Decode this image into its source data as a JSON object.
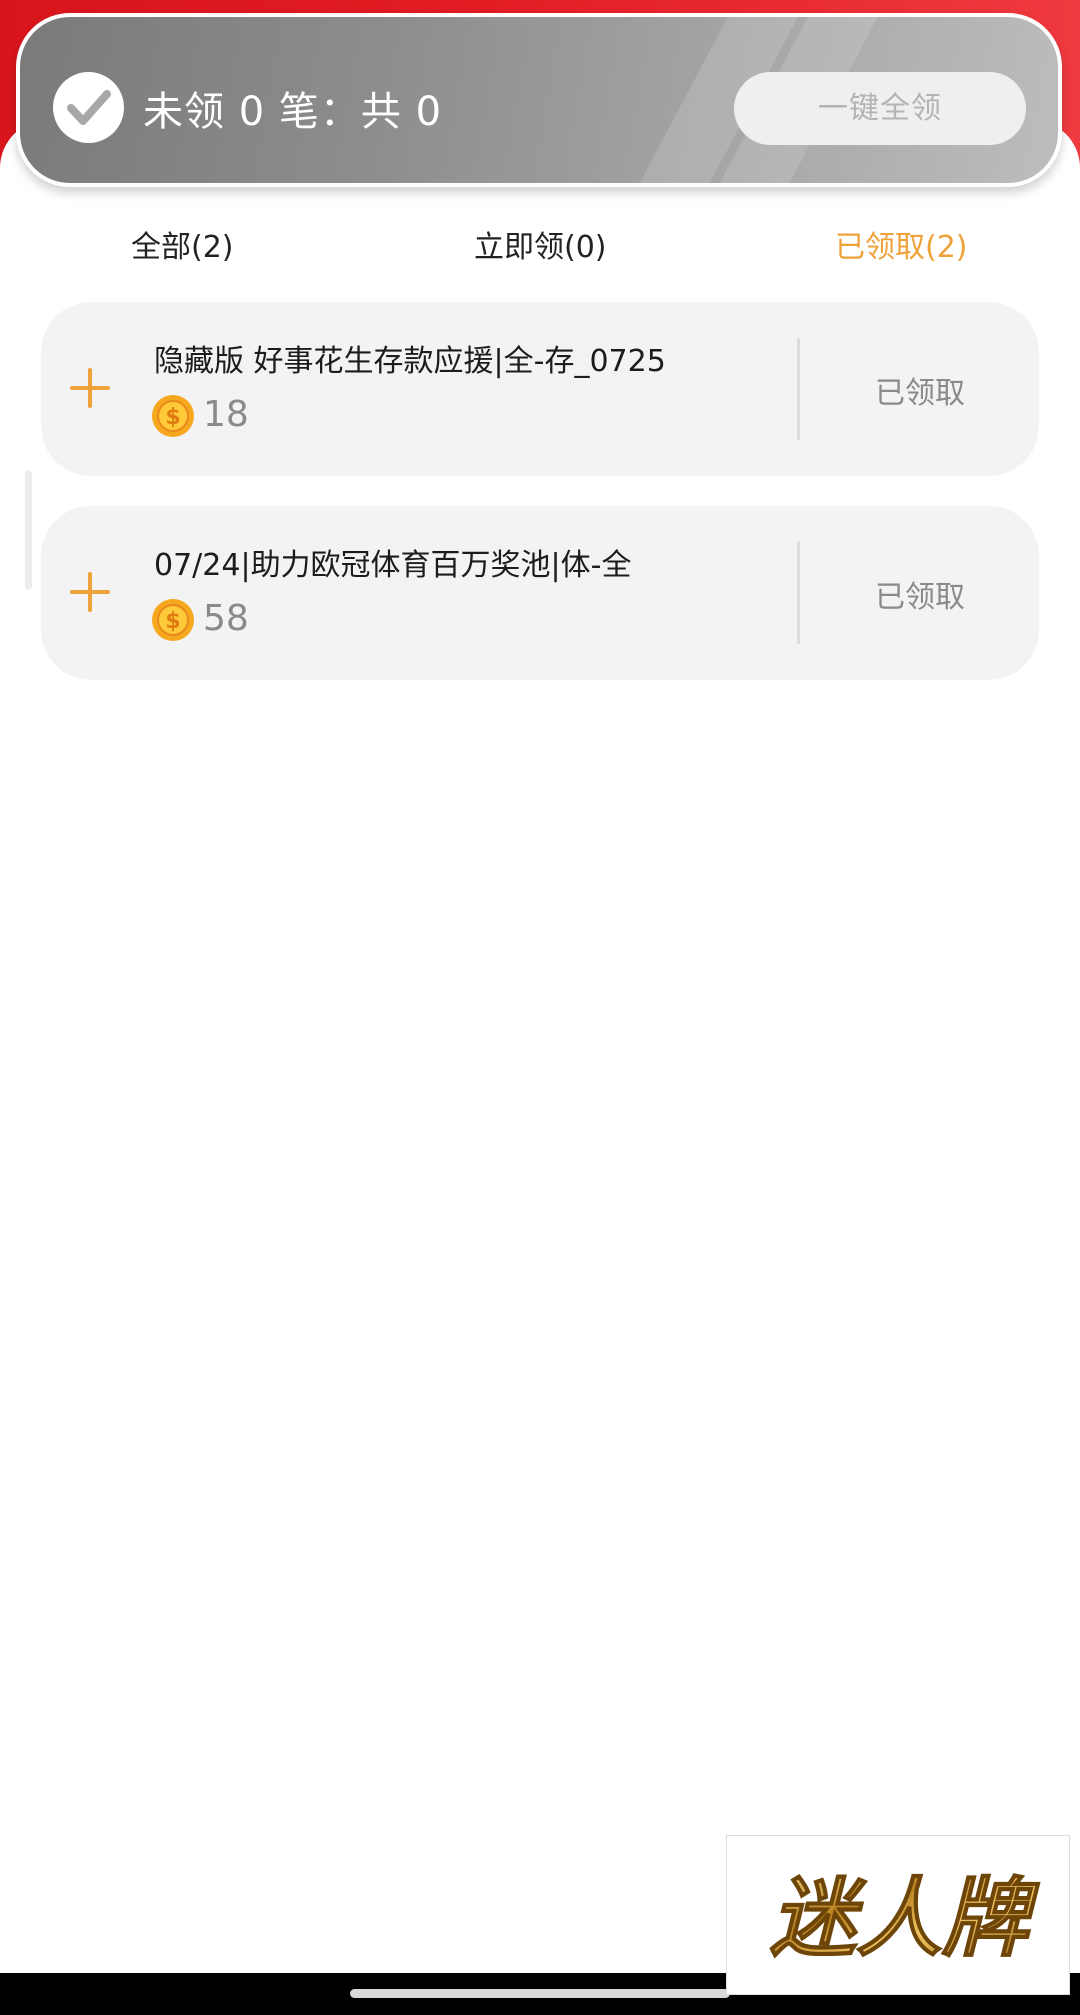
{
  "header": {
    "summary": "未领 0 笔：共 0",
    "claim_all_label": "一键全领"
  },
  "tabs": [
    {
      "label": "全部(2)",
      "active": false
    },
    {
      "label": "立即领(0)",
      "active": false
    },
    {
      "label": "已领取(2)",
      "active": true
    }
  ],
  "rewards": [
    {
      "title": "隐藏版 好事花生存款应援|全-存_0725",
      "amount": "18",
      "status": "已领取"
    },
    {
      "title": "07/24|助力欧冠体育百万奖池|体-全",
      "amount": "58",
      "status": "已领取"
    }
  ],
  "watermark": {
    "text": "迷人牌"
  },
  "colors": {
    "brand_red": "#e11d22",
    "accent_orange": "#f0a23a",
    "card_bg": "#f3f3f3",
    "muted_text": "#8a8a8a"
  }
}
